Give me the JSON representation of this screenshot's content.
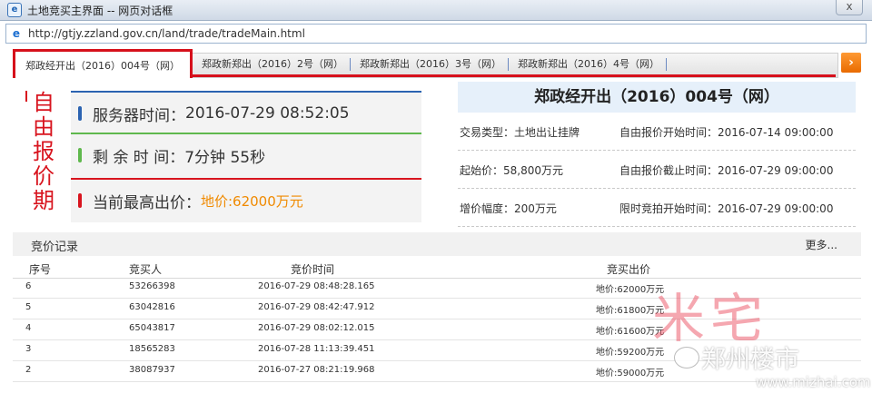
{
  "window": {
    "title": "土地竞买主界面 -- 网页对话框",
    "url": "http://gtjy.zzland.gov.cn/land/trade/tradeMain.html",
    "close_label": "x"
  },
  "tabs": [
    {
      "label": "郑政经开出（2016）004号（网）"
    },
    {
      "label": "郑政新郑出（2016）2号（网）"
    },
    {
      "label": "郑政新郑出（2016）3号（网）"
    },
    {
      "label": "郑政新郑出（2016）4号（网）"
    }
  ],
  "phase": {
    "label": "自由报价期"
  },
  "status": {
    "server_time_label": "服务器时间：",
    "server_time": "2016-07-29 08:52:05",
    "remaining_label": "剩 余 时 间：",
    "remaining": "7分钟 55秒",
    "top_bid_label": "当前最高出价：",
    "top_bid": "地价:62000万元"
  },
  "lot": {
    "title": "郑政经开出（2016）004号（网）",
    "trade_type": "交易类型：土地出让挂牌",
    "start_price": "起始价：58,800万元",
    "increment": "增价幅度：200万元",
    "free_start": "自由报价开始时间：2016-07-14 09:00:00",
    "free_end": "自由报价截止时间：2016-07-29 09:00:00",
    "auction_start": "限时竞拍开始时间：2016-07-29 09:00:00"
  },
  "records": {
    "title": "竞价记录",
    "more": "更多...",
    "columns": [
      "序号",
      "竞买人",
      "竞价时间",
      "竞买出价"
    ],
    "rows": [
      {
        "no": "6",
        "bidder": "53266398",
        "time": "2016-07-29 08:48:28.165",
        "price": "地价:62000万元"
      },
      {
        "no": "5",
        "bidder": "63042816",
        "time": "2016-07-29 08:42:47.912",
        "price": "地价:61800万元"
      },
      {
        "no": "4",
        "bidder": "65043817",
        "time": "2016-07-29 08:02:12.015",
        "price": "地价:61600万元"
      },
      {
        "no": "3",
        "bidder": "18565283",
        "time": "2016-07-28 11:13:39.451",
        "price": "地价:59200万元"
      },
      {
        "no": "2",
        "bidder": "38087937",
        "time": "2016-07-27 08:21:19.968",
        "price": "地价:59000万元"
      }
    ]
  },
  "watermark": {
    "big": "米宅",
    "name": "郑州楼市",
    "url": "www.mizhai.com"
  },
  "colors": {
    "accent_red": "#d6101b",
    "orange": "#f08a00",
    "blue": "#2b63b1",
    "green": "#5fb84d"
  }
}
